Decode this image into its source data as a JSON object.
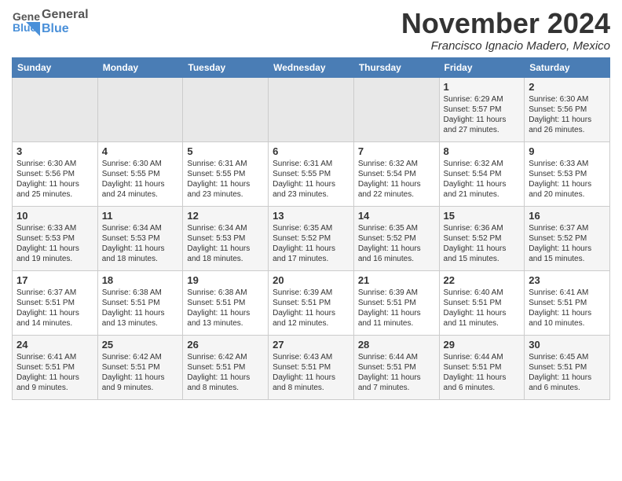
{
  "logo": {
    "line1": "General",
    "line2": "Blue"
  },
  "title": "November 2024",
  "location": "Francisco Ignacio Madero, Mexico",
  "days_of_week": [
    "Sunday",
    "Monday",
    "Tuesday",
    "Wednesday",
    "Thursday",
    "Friday",
    "Saturday"
  ],
  "weeks": [
    [
      {
        "day": "",
        "content": ""
      },
      {
        "day": "",
        "content": ""
      },
      {
        "day": "",
        "content": ""
      },
      {
        "day": "",
        "content": ""
      },
      {
        "day": "",
        "content": ""
      },
      {
        "day": "1",
        "content": "Sunrise: 6:29 AM\nSunset: 5:57 PM\nDaylight: 11 hours\nand 27 minutes."
      },
      {
        "day": "2",
        "content": "Sunrise: 6:30 AM\nSunset: 5:56 PM\nDaylight: 11 hours\nand 26 minutes."
      }
    ],
    [
      {
        "day": "3",
        "content": "Sunrise: 6:30 AM\nSunset: 5:56 PM\nDaylight: 11 hours\nand 25 minutes."
      },
      {
        "day": "4",
        "content": "Sunrise: 6:30 AM\nSunset: 5:55 PM\nDaylight: 11 hours\nand 24 minutes."
      },
      {
        "day": "5",
        "content": "Sunrise: 6:31 AM\nSunset: 5:55 PM\nDaylight: 11 hours\nand 23 minutes."
      },
      {
        "day": "6",
        "content": "Sunrise: 6:31 AM\nSunset: 5:55 PM\nDaylight: 11 hours\nand 23 minutes."
      },
      {
        "day": "7",
        "content": "Sunrise: 6:32 AM\nSunset: 5:54 PM\nDaylight: 11 hours\nand 22 minutes."
      },
      {
        "day": "8",
        "content": "Sunrise: 6:32 AM\nSunset: 5:54 PM\nDaylight: 11 hours\nand 21 minutes."
      },
      {
        "day": "9",
        "content": "Sunrise: 6:33 AM\nSunset: 5:53 PM\nDaylight: 11 hours\nand 20 minutes."
      }
    ],
    [
      {
        "day": "10",
        "content": "Sunrise: 6:33 AM\nSunset: 5:53 PM\nDaylight: 11 hours\nand 19 minutes."
      },
      {
        "day": "11",
        "content": "Sunrise: 6:34 AM\nSunset: 5:53 PM\nDaylight: 11 hours\nand 18 minutes."
      },
      {
        "day": "12",
        "content": "Sunrise: 6:34 AM\nSunset: 5:53 PM\nDaylight: 11 hours\nand 18 minutes."
      },
      {
        "day": "13",
        "content": "Sunrise: 6:35 AM\nSunset: 5:52 PM\nDaylight: 11 hours\nand 17 minutes."
      },
      {
        "day": "14",
        "content": "Sunrise: 6:35 AM\nSunset: 5:52 PM\nDaylight: 11 hours\nand 16 minutes."
      },
      {
        "day": "15",
        "content": "Sunrise: 6:36 AM\nSunset: 5:52 PM\nDaylight: 11 hours\nand 15 minutes."
      },
      {
        "day": "16",
        "content": "Sunrise: 6:37 AM\nSunset: 5:52 PM\nDaylight: 11 hours\nand 15 minutes."
      }
    ],
    [
      {
        "day": "17",
        "content": "Sunrise: 6:37 AM\nSunset: 5:51 PM\nDaylight: 11 hours\nand 14 minutes."
      },
      {
        "day": "18",
        "content": "Sunrise: 6:38 AM\nSunset: 5:51 PM\nDaylight: 11 hours\nand 13 minutes."
      },
      {
        "day": "19",
        "content": "Sunrise: 6:38 AM\nSunset: 5:51 PM\nDaylight: 11 hours\nand 13 minutes."
      },
      {
        "day": "20",
        "content": "Sunrise: 6:39 AM\nSunset: 5:51 PM\nDaylight: 11 hours\nand 12 minutes."
      },
      {
        "day": "21",
        "content": "Sunrise: 6:39 AM\nSunset: 5:51 PM\nDaylight: 11 hours\nand 11 minutes."
      },
      {
        "day": "22",
        "content": "Sunrise: 6:40 AM\nSunset: 5:51 PM\nDaylight: 11 hours\nand 11 minutes."
      },
      {
        "day": "23",
        "content": "Sunrise: 6:41 AM\nSunset: 5:51 PM\nDaylight: 11 hours\nand 10 minutes."
      }
    ],
    [
      {
        "day": "24",
        "content": "Sunrise: 6:41 AM\nSunset: 5:51 PM\nDaylight: 11 hours\nand 9 minutes."
      },
      {
        "day": "25",
        "content": "Sunrise: 6:42 AM\nSunset: 5:51 PM\nDaylight: 11 hours\nand 9 minutes."
      },
      {
        "day": "26",
        "content": "Sunrise: 6:42 AM\nSunset: 5:51 PM\nDaylight: 11 hours\nand 8 minutes."
      },
      {
        "day": "27",
        "content": "Sunrise: 6:43 AM\nSunset: 5:51 PM\nDaylight: 11 hours\nand 8 minutes."
      },
      {
        "day": "28",
        "content": "Sunrise: 6:44 AM\nSunset: 5:51 PM\nDaylight: 11 hours\nand 7 minutes."
      },
      {
        "day": "29",
        "content": "Sunrise: 6:44 AM\nSunset: 5:51 PM\nDaylight: 11 hours\nand 6 minutes."
      },
      {
        "day": "30",
        "content": "Sunrise: 6:45 AM\nSunset: 5:51 PM\nDaylight: 11 hours\nand 6 minutes."
      }
    ]
  ]
}
